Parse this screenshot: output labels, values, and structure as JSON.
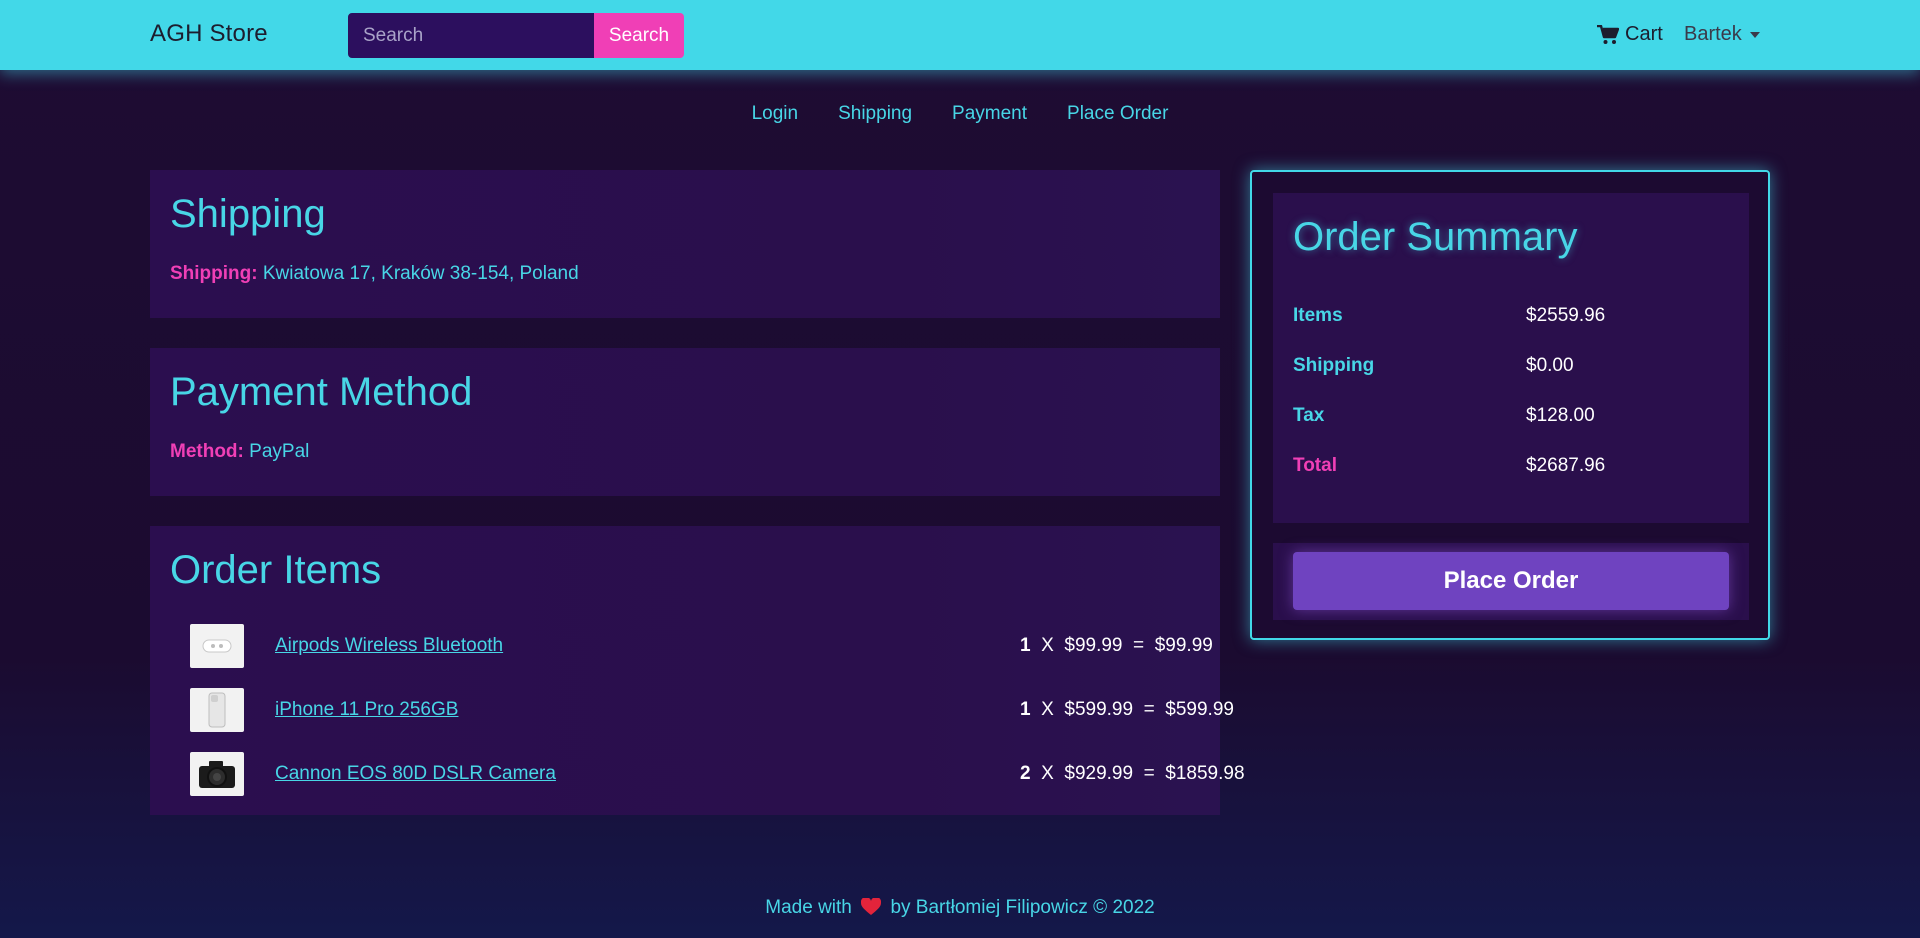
{
  "navbar": {
    "brand": "AGH Store",
    "search": {
      "placeholder": "Search",
      "button_label": "Search"
    },
    "cart_label": "Cart",
    "user_label": "Bartek"
  },
  "steps": [
    "Login",
    "Shipping",
    "Payment",
    "Place Order"
  ],
  "shipping": {
    "title": "Shipping",
    "label": "Shipping:",
    "address": "Kwiatowa 17, Kraków 38-154, Poland"
  },
  "payment": {
    "title": "Payment Method",
    "label": "Method:",
    "method": "PayPal"
  },
  "order_items": {
    "title": "Order Items",
    "items": [
      {
        "name": "Airpods Wireless Bluetooth",
        "qty": "1",
        "price": "$99.99",
        "subtotal": "$99.99",
        "thumb_icon": "airpods-icon"
      },
      {
        "name": "iPhone 11 Pro 256GB",
        "qty": "1",
        "price": "$599.99",
        "subtotal": "$599.99",
        "thumb_icon": "iphone-icon"
      },
      {
        "name": "Cannon EOS 80D DSLR Camera",
        "qty": "2",
        "price": "$929.99",
        "subtotal": "$1859.98",
        "thumb_icon": "camera-icon"
      }
    ]
  },
  "summary": {
    "title": "Order Summary",
    "rows": [
      {
        "label": "Items",
        "value": "$2559.96"
      },
      {
        "label": "Shipping",
        "value": "$0.00"
      },
      {
        "label": "Tax",
        "value": "$128.00"
      },
      {
        "label": "Total",
        "value": "$2687.96"
      }
    ],
    "button_label": "Place Order"
  },
  "footer": {
    "prefix": "Made with",
    "suffix": "by Bartłomiej Filipowicz © 2022",
    "heart_icon": "heart-icon"
  },
  "colors": {
    "navbar": "#42d8e8",
    "accent_pink": "#f03fb6",
    "accent_cyan": "#48d6e6",
    "button_purple": "#6f43c0",
    "background": "#1e0c33"
  }
}
